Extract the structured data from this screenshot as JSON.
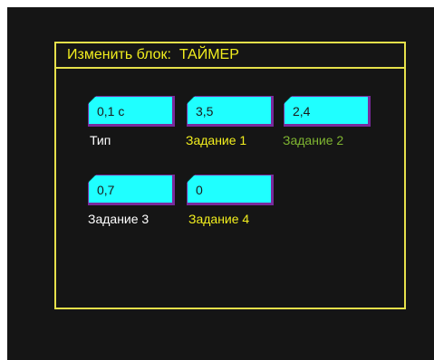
{
  "dialog": {
    "title": "Изменить блок:  ТАЙМЕР"
  },
  "fields": [
    {
      "value": "0,1 с",
      "label": "Тип",
      "label_color": "#ffffff"
    },
    {
      "value": "3,5",
      "label": "Задание 1",
      "label_color": "#f2ee1e"
    },
    {
      "value": "2,4",
      "label": "Задание 2",
      "label_color": "#7fb531"
    },
    {
      "value": "0,7",
      "label": "Задание 3",
      "label_color": "#ffffff"
    },
    {
      "value": "0",
      "label": "Задание 4",
      "label_color": "#f2ee1e"
    }
  ],
  "colors": {
    "frame": "#e6e04a",
    "field_fill": "#1fffff",
    "field_border": "#7a2a9c",
    "background": "#151515"
  }
}
